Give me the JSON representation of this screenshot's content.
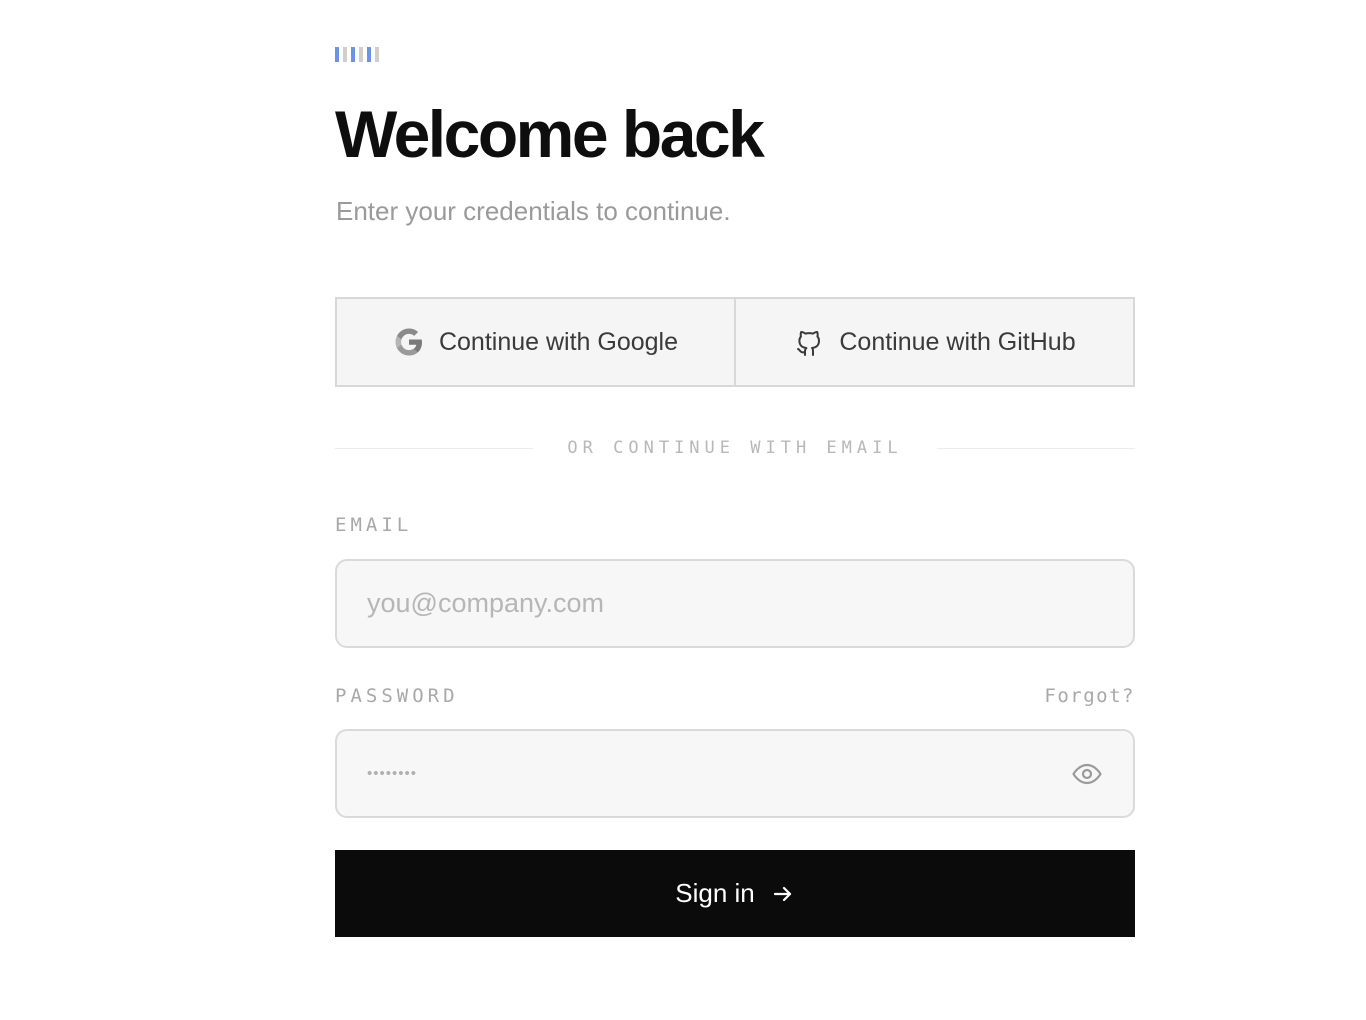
{
  "logo": {
    "bar_colors": [
      "#6b93e8",
      "#cfcfcf",
      "#6b93e8",
      "#cfcfcf",
      "#6b93e8",
      "#cfcfcf"
    ]
  },
  "header": {
    "title": "Welcome back",
    "subtitle": "Enter your credentials to continue."
  },
  "oauth": {
    "google_label": "Continue with Google",
    "google_icon": "google-icon",
    "github_label": "Continue with GitHub",
    "github_icon": "github-icon"
  },
  "divider": {
    "text": "OR CONTINUE WITH EMAIL"
  },
  "email": {
    "label": "EMAIL",
    "placeholder": "you@company.com",
    "value": ""
  },
  "password": {
    "label": "PASSWORD",
    "forgot_label": "Forgot?",
    "masked_value": "••••••••",
    "toggle_icon": "eye-icon"
  },
  "submit": {
    "label": "Sign in",
    "icon": "arrow-right-icon"
  },
  "colors": {
    "primary_button": "#0b0b0b",
    "accent": "#6b93e8"
  }
}
